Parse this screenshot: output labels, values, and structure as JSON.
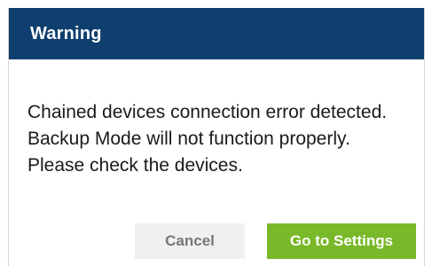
{
  "dialog": {
    "title": "Warning",
    "message": "Chained devices connection error detected. Backup Mode will not function properly. Please check the devices.",
    "buttons": {
      "cancel_label": "Cancel",
      "primary_label": "Go to Settings"
    }
  },
  "colors": {
    "header_bg": "#0e3f6e",
    "primary_button": "#79b829",
    "cancel_button": "#f0f0f0"
  }
}
